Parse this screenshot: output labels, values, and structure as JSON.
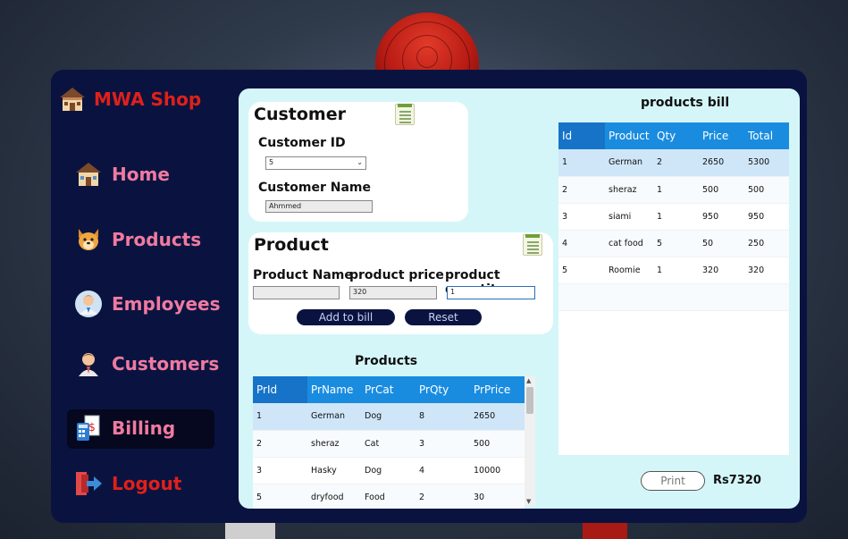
{
  "brand": {
    "title": "MWA Shop",
    "icon": "shop-icon"
  },
  "nav": [
    {
      "label": "Home",
      "icon": "house-icon"
    },
    {
      "label": "Products",
      "icon": "dog-icon"
    },
    {
      "label": "Employees",
      "icon": "employee-icon"
    },
    {
      "label": "Customers",
      "icon": "customer-icon"
    },
    {
      "label": "Billing",
      "icon": "calculator-icon"
    },
    {
      "label": "Logout",
      "icon": "logout-icon"
    }
  ],
  "customer": {
    "title": "Customer",
    "id_label": "Customer ID",
    "id_value": "5",
    "name_label": "Customer Name",
    "name_value": "Ahmmed"
  },
  "product": {
    "title": "Product",
    "name_label": "Product Name",
    "price_label": "product price",
    "qty_label": "product quantity",
    "name_value": "",
    "price_value": "320",
    "qty_value": "1",
    "add_label": "Add to bill",
    "reset_label": "Reset"
  },
  "products_table": {
    "title": "Products",
    "columns": [
      "PrId",
      "PrName",
      "PrCat",
      "PrQty",
      "PrPrice"
    ],
    "rows": [
      [
        "1",
        "German",
        "Dog",
        "8",
        "2650"
      ],
      [
        "2",
        "sheraz",
        "Cat",
        "3",
        "500"
      ],
      [
        "3",
        "Hasky",
        "Dog",
        "4",
        "10000"
      ],
      [
        "5",
        "dryfood",
        "Food",
        "2",
        "30"
      ]
    ]
  },
  "bill": {
    "title": "products bill",
    "columns": [
      "Id",
      "Product",
      "Qty",
      "Price",
      "Total"
    ],
    "rows": [
      [
        "1",
        "German",
        "2",
        "2650",
        "5300"
      ],
      [
        "2",
        "sheraz",
        "1",
        "500",
        "500"
      ],
      [
        "3",
        "siami",
        "1",
        "950",
        "950"
      ],
      [
        "4",
        "cat food",
        "5",
        "50",
        "250"
      ],
      [
        "5",
        "Roomie",
        "1",
        "320",
        "320"
      ]
    ],
    "print_label": "Print",
    "total": "Rs7320"
  },
  "colors": {
    "sidebar": "#0a1340",
    "content": "#d4f6f8",
    "header": "#1a8ce0",
    "nav_text": "#f07aa0",
    "brand": "#e0201a"
  }
}
